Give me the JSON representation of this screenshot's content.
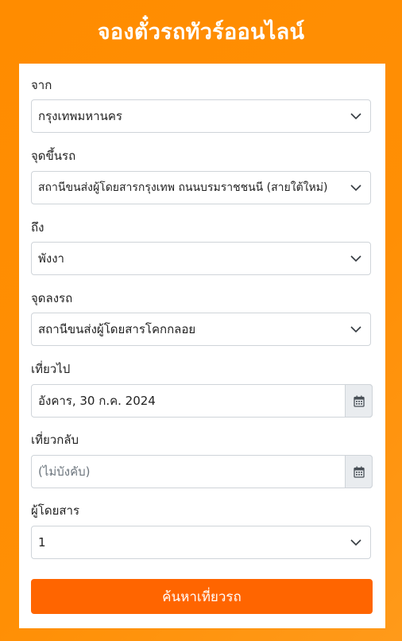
{
  "header": {
    "title": "จองตั๋วรถทัวร์ออนไลน์"
  },
  "form": {
    "from_label": "จาก",
    "from_value": "กรุงเทพมหานคร",
    "boarding_label": "จุดขึ้นรถ",
    "boarding_value": "สถานีขนส่งผู้โดยสารกรุงเทพ ถนนบรมราชชนนี (สายใต้ใหม่)",
    "to_label": "ถึง",
    "to_value": "พังงา",
    "dropoff_label": "จุดลงรถ",
    "dropoff_value": "สถานีขนส่งผู้โดยสารโคกกลอย",
    "depart_label": "เที่ยวไป",
    "depart_value": "อังคาร, 30 ก.ค. 2024",
    "return_label": "เที่ยวกลับ",
    "return_placeholder": "(ไม่บังคับ)",
    "passengers_label": "ผู้โดยสาร",
    "passengers_value": "1",
    "submit_label": "ค้นหาเที่ยวรถ"
  },
  "icons": {
    "select_arrow": "chevron-down-icon",
    "calendar": "calendar-icon"
  },
  "colors": {
    "background": "#ff8c00",
    "button": "#ff6500",
    "addon": "#e9ecef"
  }
}
